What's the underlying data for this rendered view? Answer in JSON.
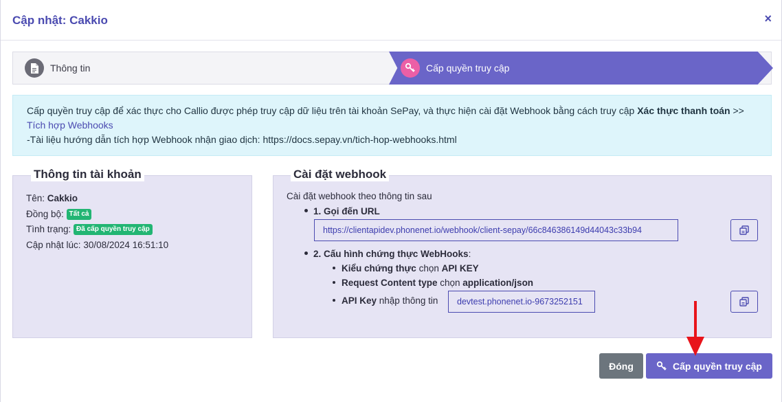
{
  "modal": {
    "title": "Cập nhật: Cakkio",
    "close_label": "×"
  },
  "stepper": {
    "steps": [
      {
        "label": "Thông tin",
        "icon": "document-icon",
        "active": false
      },
      {
        "label": "Cấp quyền truy cập",
        "icon": "key-icon",
        "active": true
      }
    ]
  },
  "alert": {
    "line1": "Cấp quyền truy cập để xác thực cho Callio được phép truy cập dữ liệu trên tài khoản SePay, và thực hiện cài đặt Webhook bằng cách truy cập ",
    "bold_part": "Xác thực thanh toán",
    "sep": " >> ",
    "link": "Tích hợp Webhooks",
    "line2": "-Tài liệu hướng dẫn tích hợp Webhook nhận giao dịch: https://docs.sepay.vn/tich-hop-webhooks.html"
  },
  "account": {
    "title": "Thông tin tài khoản",
    "name_label": "Tên: ",
    "name_value": "Cakkio",
    "sync_label": "Đồng bộ: ",
    "sync_badge": "Tất cả",
    "status_label": "Tình trạng: ",
    "status_badge": "Đã cấp quyền truy cập",
    "updated_label": "Cập nhật lúc: ",
    "updated_value": "30/08/2024 16:51:10"
  },
  "webhook": {
    "title": "Cài đặt webhook",
    "intro": "Cài đặt webhook theo thông tin sau",
    "step1_title": "1. Gọi đến URL",
    "url_value": "https://clientapidev.phonenet.io/webhook/client-sepay/66c846386149d44043c33b94",
    "step2_title": "2. Cấu hình chứng thực WebHooks",
    "step2_colon": ":",
    "auth_type_label": "Kiểu chứng thực",
    "auth_type_mid": " chọn ",
    "auth_type_value": "API KEY",
    "content_type_label": "Request Content type",
    "content_type_mid": " chọn ",
    "content_type_value": "application/json",
    "api_key_label": "API Key",
    "api_key_mid": " nhập thông tin ",
    "api_key_value": "devtest.phonenet.io-9673252151"
  },
  "footer": {
    "close_label": "Đóng",
    "grant_label": "Cấp quyền truy cập"
  },
  "colors": {
    "accent": "#6a65c8",
    "title": "#4a4ab0",
    "pink": "#ec5fa6",
    "success": "#22b573",
    "secondary": "#6c757d",
    "annotation": "#e8141b"
  }
}
